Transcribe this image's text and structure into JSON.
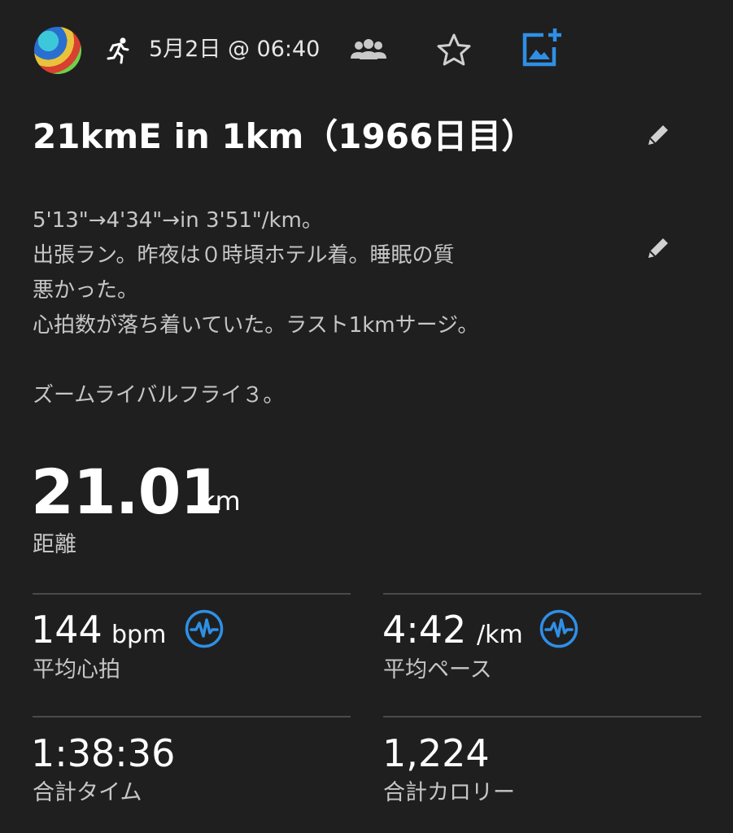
{
  "header": {
    "date_time": "5月2日 @ 06:40",
    "icons": {
      "activity": "running-person-icon",
      "group": "group-icon",
      "favorite": "star-outline-icon",
      "add_photo": "add-photo-icon"
    },
    "accent_color": "#2f8fe6"
  },
  "activity": {
    "title": "21kmE in 1km（1966日目）",
    "notes": [
      "5'13\"→4'34\"→in 3'51\"/km。",
      "出張ラン。昨夜は０時頃ホテル着。睡眠の質",
      "悪かった。",
      "心拍数が落ち着いていた。ラスト1kmサージ。",
      "",
      "ズームライバルフライ３。"
    ]
  },
  "distance": {
    "value": "21.01",
    "unit": "km",
    "label": "距離"
  },
  "stats": [
    {
      "value": "144",
      "unit": "bpm",
      "label": "平均心拍",
      "icon": "heart-rate-wave-icon"
    },
    {
      "value": "4:42",
      "unit": "/km",
      "label": "平均ペース",
      "icon": "pace-wave-icon"
    },
    {
      "value": "1:38:36",
      "unit": "",
      "label": "合計タイム"
    },
    {
      "value": "1,224",
      "unit": "",
      "label": "合計カロリー"
    }
  ]
}
